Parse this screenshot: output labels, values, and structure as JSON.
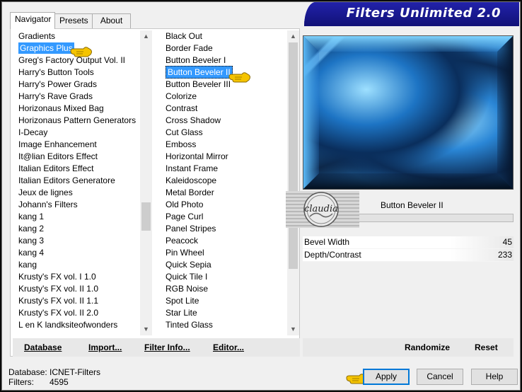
{
  "banner": {
    "title": "Filters Unlimited 2.0"
  },
  "tabs": [
    {
      "label": "Navigator"
    },
    {
      "label": "Presets"
    },
    {
      "label": "About"
    }
  ],
  "categories": {
    "items": [
      "Gradients",
      "Graphics Plus",
      "Greg's Factory Output Vol. II",
      "Harry's Button Tools",
      "Harry's Power Grads",
      "Harry's Rave Grads",
      "Horizonaus Mixed Bag",
      "Horizonaus Pattern Generators",
      "I-Decay",
      "Image Enhancement",
      "It@lian Editors Effect",
      "Italian Editors Effect",
      "Italian Editors Generatore",
      "Jeux de lignes",
      "Johann's Filters",
      "kang 1",
      "kang 2",
      "kang 3",
      "kang 4",
      "kang",
      "Krusty's FX vol. I 1.0",
      "Krusty's FX vol. II 1.0",
      "Krusty's FX vol. II 1.1",
      "Krusty's FX vol. II 2.0",
      "L en K landksiteofwonders"
    ],
    "selected": "Graphics Plus"
  },
  "filters": {
    "items": [
      "Black Out",
      "Border Fade",
      "Button Beveler I",
      "Button Beveler II",
      "Button Beveler III",
      "Colorize",
      "Contrast",
      "Cross Shadow",
      "Cut Glass",
      "Emboss",
      "Horizontal Mirror",
      "Instant Frame",
      "Kaleidoscope",
      "Metal Border",
      "Old Photo",
      "Page Curl",
      "Panel Stripes",
      "Peacock",
      "Pin Wheel",
      "Quick Sepia",
      "Quick Tile I",
      "RGB Noise",
      "Spot Lite",
      "Star Lite",
      "Tinted Glass"
    ],
    "selected": "Button Beveler II"
  },
  "left_buttons": {
    "database": "Database",
    "import": "Import...",
    "filter_info": "Filter Info...",
    "editor": "Editor..."
  },
  "preview": {
    "watermark_text": "claudia",
    "filter_name": "Button Beveler II"
  },
  "params": [
    {
      "label": "Bevel Width",
      "value": "45"
    },
    {
      "label": "Depth/Contrast",
      "value": "233"
    }
  ],
  "right_buttons": {
    "randomize": "Randomize",
    "reset": "Reset"
  },
  "status": {
    "database_label": "Database:",
    "database_value": "ICNET-Filters",
    "filters_label": "Filters:",
    "filters_value": "4595"
  },
  "dialog_buttons": {
    "apply": "Apply",
    "cancel": "Cancel",
    "help": "Help"
  },
  "colors": {
    "banner_bg": "#1a1a8a",
    "selection": "#3399ff",
    "pointer": "#f5c400",
    "default_button_border": "#0078d7"
  }
}
